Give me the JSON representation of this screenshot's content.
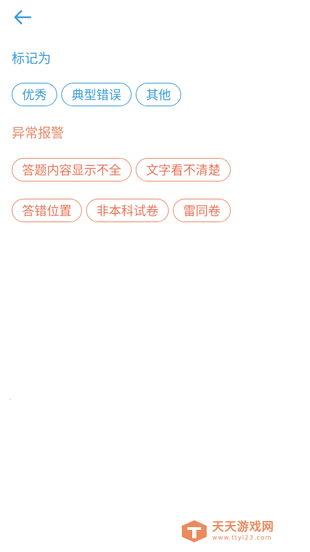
{
  "header": {
    "back_icon": "arrow-left-icon"
  },
  "mark_section": {
    "title": "标记为",
    "chips": [
      "优秀",
      "典型错误",
      "其他"
    ]
  },
  "alert_section": {
    "title": "异常报警",
    "chips_row1": [
      "答题内容显示不全",
      "文字看不清楚"
    ],
    "chips_row2": [
      "答错位置",
      "非本科试卷",
      "雷同卷"
    ]
  },
  "watermark": {
    "name": "天天游戏网",
    "url": "www.ttyl23.com"
  },
  "colors": {
    "accent_blue": "#3a9bd5",
    "alert_orange": "#e88a6a",
    "watermark_orange": "#ec8a5c"
  }
}
